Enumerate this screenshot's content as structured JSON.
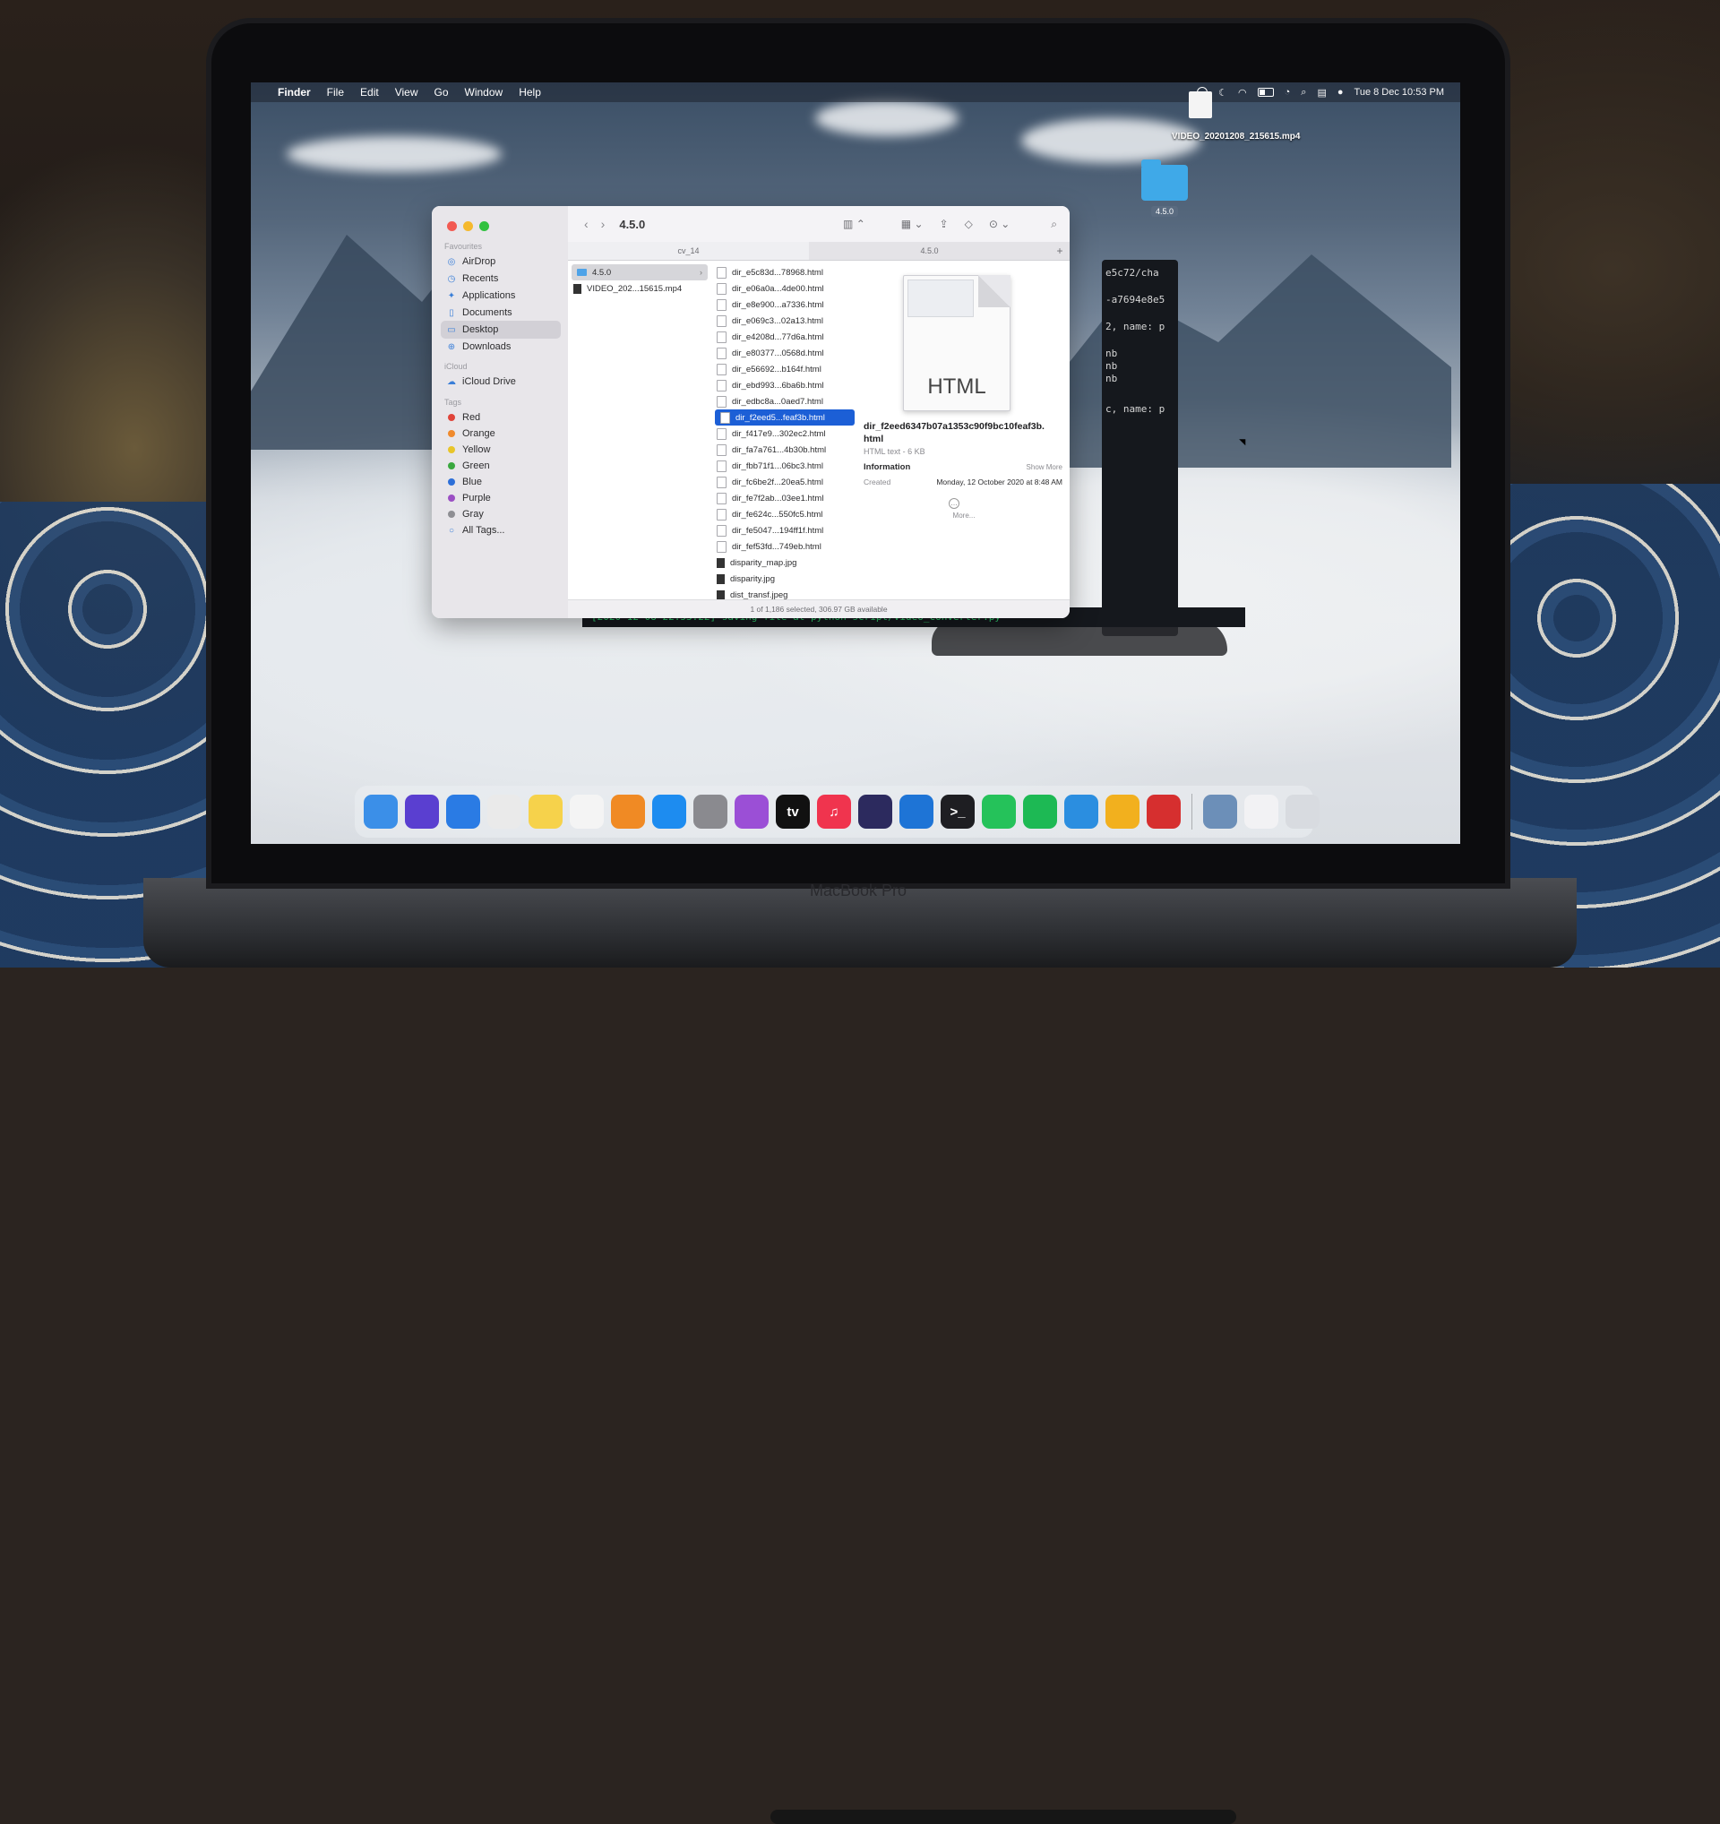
{
  "menubar": {
    "app": "Finder",
    "items": [
      "File",
      "Edit",
      "View",
      "Go",
      "Window",
      "Help"
    ],
    "datetime": "Tue 8 Dec  10:53 PM"
  },
  "desktop": {
    "video_file": "VIDEO_20201208_215615.mp4",
    "folder_tag": "4.5.0"
  },
  "finder": {
    "title": "4.5.0",
    "tabs": [
      "cv_14",
      "4.5.0"
    ],
    "sidebar": {
      "favourites_header": "Favourites",
      "favourites": [
        "AirDrop",
        "Recents",
        "Applications",
        "Documents",
        "Desktop",
        "Downloads"
      ],
      "icloud_header": "iCloud",
      "icloud": [
        "iCloud Drive"
      ],
      "tags_header": "Tags",
      "tags": [
        {
          "name": "Red",
          "color": "#e0443a"
        },
        {
          "name": "Orange",
          "color": "#f08a2c"
        },
        {
          "name": "Yellow",
          "color": "#e8c52a"
        },
        {
          "name": "Green",
          "color": "#3aa83f"
        },
        {
          "name": "Blue",
          "color": "#2d6fd8"
        },
        {
          "name": "Purple",
          "color": "#9b4fc4"
        },
        {
          "name": "Gray",
          "color": "#8e8e93"
        }
      ],
      "all_tags": "All Tags..."
    },
    "column1": [
      "4.5.0",
      "VIDEO_202...15615.mp4"
    ],
    "column2": [
      "dir_e5c83d...78968.html",
      "dir_e06a0a...4de00.html",
      "dir_e8e900...a7336.html",
      "dir_e069c3...02a13.html",
      "dir_e4208d...77d6a.html",
      "dir_e80377...0568d.html",
      "dir_e56692...b164f.html",
      "dir_ebd993...6ba6b.html",
      "dir_edbc8a...0aed7.html",
      "dir_f2eed5...feaf3b.html",
      "dir_f417e9...302ec2.html",
      "dir_fa7a761...4b30b.html",
      "dir_fbb71f1...06bc3.html",
      "dir_fc6be2f...20ea5.html",
      "dir_fe7f2ab...03ee1.html",
      "dir_fe624c...550fc5.html",
      "dir_fe5047...194ff1f.html",
      "dir_fef53fd...749eb.html",
      "disparity_map.jpg",
      "disparity.jpg",
      "dist_transf.jpeg"
    ],
    "preview": {
      "ext": "HTML",
      "name": "dir_f2eed6347b07a1353c90f9bc10feaf3b.html",
      "kind": "HTML text - 6 KB",
      "info_label": "Information",
      "show_more": "Show More",
      "created_label": "Created",
      "created_value": "Monday, 12 October 2020 at 8:48 AM",
      "more_label": "More..."
    },
    "status": "1 of 1,186 selected, 306.97 GB available"
  },
  "terminal": {
    "lines": [
      "e5c72/cha",
      "-a7694e8e5",
      "2, name: p",
      "nb",
      "nb",
      "nb",
      "c, name: p"
    ],
    "bottom": "[2020-12-08 22:53:22] saving file at python script/video_converter.py"
  },
  "dock": {
    "apps": [
      {
        "name": "finder",
        "color": "#3b8fe8",
        "glyph": ""
      },
      {
        "name": "siri",
        "color": "#5a3fd0",
        "glyph": ""
      },
      {
        "name": "safari",
        "color": "#2a7be4",
        "glyph": ""
      },
      {
        "name": "launchpad",
        "color": "#eaeaea",
        "glyph": ""
      },
      {
        "name": "notes",
        "color": "#f6d24b",
        "glyph": ""
      },
      {
        "name": "reminders",
        "color": "#f4f4f4",
        "glyph": ""
      },
      {
        "name": "books",
        "color": "#f08a24",
        "glyph": ""
      },
      {
        "name": "app-store",
        "color": "#1d8cf0",
        "glyph": ""
      },
      {
        "name": "system-preferences",
        "color": "#8a8a8f",
        "glyph": ""
      },
      {
        "name": "podcasts",
        "color": "#9b4fd6",
        "glyph": ""
      },
      {
        "name": "apple-tv",
        "color": "#111111",
        "glyph": "tv"
      },
      {
        "name": "music",
        "color": "#f0344e",
        "glyph": "♫"
      },
      {
        "name": "eclipse",
        "color": "#2c2a5e",
        "glyph": ""
      },
      {
        "name": "xcode",
        "color": "#1e74d6",
        "glyph": ""
      },
      {
        "name": "terminal",
        "color": "#1e1e22",
        "glyph": ">_"
      },
      {
        "name": "whatsapp",
        "color": "#25c25a",
        "glyph": ""
      },
      {
        "name": "spotify",
        "color": "#1db954",
        "glyph": ""
      },
      {
        "name": "vscode",
        "color": "#2b8ee0",
        "glyph": ""
      },
      {
        "name": "chrome",
        "color": "#f2b01e",
        "glyph": ""
      },
      {
        "name": "filezilla",
        "color": "#d62f2f",
        "glyph": ""
      },
      {
        "name": "preview",
        "color": "#6c8fb8",
        "glyph": ""
      }
    ]
  },
  "laptop_brand": "MacBook Pro"
}
